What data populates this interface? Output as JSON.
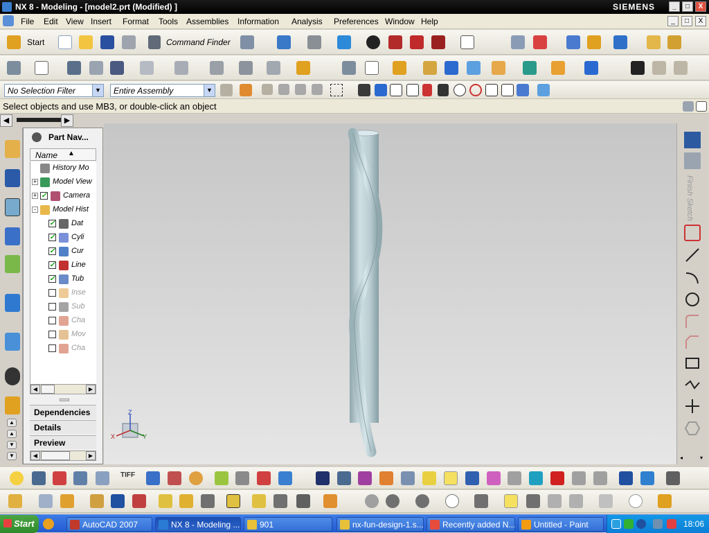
{
  "window": {
    "title": "NX 8 - Modeling - [model2.prt (Modified) ]",
    "brand": "SIEMENS",
    "controls": [
      "_",
      "□",
      "X"
    ]
  },
  "menu": {
    "items": [
      "File",
      "Edit",
      "View",
      "Insert",
      "Format",
      "Tools",
      "Assemblies",
      "Information",
      "Analysis",
      "Preferences",
      "Window",
      "Help"
    ]
  },
  "toolbar": {
    "start_label": "Start",
    "command_finder_label": "Command Finder"
  },
  "selection": {
    "filter": "No Selection Filter",
    "scope": "Entire Assembly"
  },
  "cue": {
    "text": "Select objects and use MB3, or double-click an object"
  },
  "navigator": {
    "title": "Part Nav...",
    "column_header": "Name",
    "tree": [
      {
        "label": "History Mo",
        "icon": "clock-icon",
        "checked": null,
        "expander": null,
        "dimmed": false
      },
      {
        "label": "Model View",
        "icon": "model-views-icon",
        "checked": null,
        "expander": "+",
        "dimmed": false
      },
      {
        "label": "Camera",
        "icon": "camera-icon",
        "checked": true,
        "expander": "+",
        "dimmed": false
      },
      {
        "label": "Model Hist",
        "icon": "folder-icon",
        "checked": null,
        "expander": "-",
        "dimmed": false
      },
      {
        "label": "Dat",
        "icon": "datum-csys-icon",
        "checked": true,
        "expander": null,
        "dimmed": false
      },
      {
        "label": "Cyli",
        "icon": "cylinder-icon",
        "checked": true,
        "expander": null,
        "dimmed": false
      },
      {
        "label": "Cur",
        "icon": "curve-icon",
        "checked": true,
        "expander": null,
        "dimmed": false
      },
      {
        "label": "Line",
        "icon": "line-icon",
        "checked": true,
        "expander": null,
        "dimmed": false
      },
      {
        "label": "Tub",
        "icon": "tube-icon",
        "checked": true,
        "expander": null,
        "dimmed": false
      },
      {
        "label": "Inse",
        "icon": "insert-icon",
        "checked": false,
        "expander": null,
        "dimmed": true
      },
      {
        "label": "Sub",
        "icon": "subtract-icon",
        "checked": false,
        "expander": null,
        "dimmed": true
      },
      {
        "label": "Cha",
        "icon": "chamfer-icon",
        "checked": false,
        "expander": null,
        "dimmed": true
      },
      {
        "label": "Mov",
        "icon": "move-face-icon",
        "checked": false,
        "expander": null,
        "dimmed": true
      },
      {
        "label": "Cha",
        "icon": "chamfer-icon",
        "checked": false,
        "expander": null,
        "dimmed": true
      }
    ],
    "panels": [
      "Dependencies",
      "Details",
      "Preview"
    ]
  },
  "sketch_palette": {
    "finish_label": "Finish Sketch"
  },
  "viewport": {
    "triad": {
      "x_label": "X",
      "y_label": "Y",
      "z_label": "Z"
    }
  },
  "toolbar_extra": {
    "tiff_label": "TIFF"
  },
  "taskbar": {
    "start_label": "Start",
    "items": [
      {
        "label": "AutoCAD 2007",
        "active": false,
        "color": "#c0392b"
      },
      {
        "label": "NX 8 - Modeling ...",
        "active": true,
        "color": "#2a7bd3"
      },
      {
        "label": "901",
        "active": false,
        "color": "#e7c13a"
      },
      {
        "label": "nx-fun-design-1.s...",
        "active": false,
        "color": "#e7c13a"
      },
      {
        "label": "Recently added N...",
        "active": false,
        "color": "#e74c3c"
      },
      {
        "label": "Untitled - Paint",
        "active": false,
        "color": "#f39c12"
      }
    ],
    "clock": "18:06"
  }
}
